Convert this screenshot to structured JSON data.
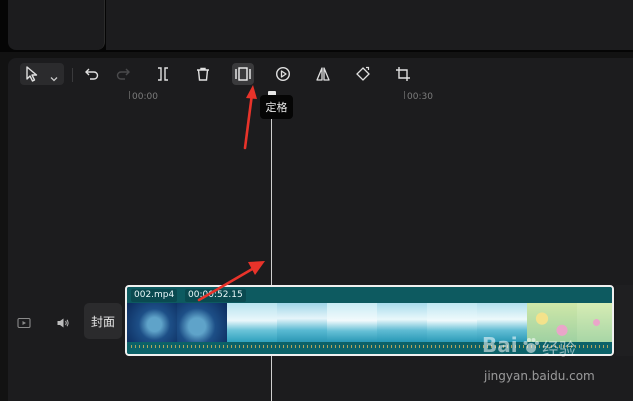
{
  "toolbar": {
    "tools": [
      {
        "name": "select-tool"
      },
      {
        "name": "undo"
      },
      {
        "name": "redo"
      },
      {
        "name": "split"
      },
      {
        "name": "delete"
      },
      {
        "name": "freeze"
      },
      {
        "name": "play"
      },
      {
        "name": "mirror"
      },
      {
        "name": "rotate"
      },
      {
        "name": "crop"
      }
    ]
  },
  "ruler": {
    "labels": [
      "00:00",
      "00:30"
    ]
  },
  "tooltip": {
    "freeze": "定格"
  },
  "track": {
    "cover_label": "封面"
  },
  "clip": {
    "filename": "002.mp4",
    "duration": "00:00:52.15"
  },
  "watermark": {
    "brand": "Bai",
    "brand_suffix": "经验",
    "url": "jingyan.baidu.com"
  },
  "colors": {
    "background": "#121212",
    "panel": "#1c1c1e",
    "clip_accent": "#0f6c72",
    "annotation_arrow": "#e8332a"
  }
}
